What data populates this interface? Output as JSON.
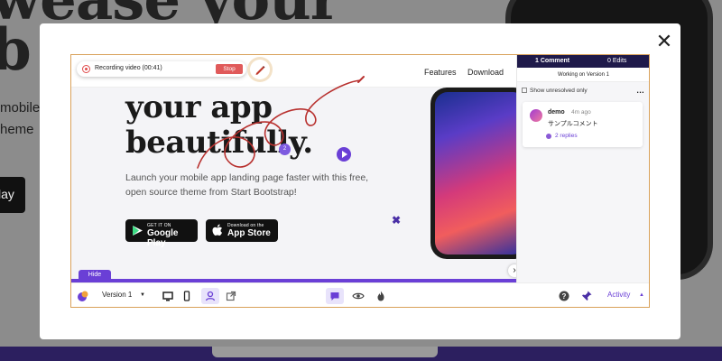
{
  "background": {
    "hero_text": "wease your",
    "hero_text_line2": "b",
    "sub_line1": "mobile",
    "sub_line2": "heme",
    "button_partial": "lay"
  },
  "recording": {
    "status": "Recording video (00:41)",
    "stop_label": "Stop"
  },
  "nav": {
    "links": [
      "Features",
      "Download"
    ]
  },
  "hero": {
    "title_line1": "your app",
    "title_line2": "beautifully.",
    "subtitle": "Launch your mobile app landing page faster with this free, open source theme from Start Bootstrap!",
    "pin_number": "2"
  },
  "stores": {
    "google_small": "GET IT ON",
    "google_big": "Google Play",
    "apple_small": "Download on the",
    "apple_big": "App Store"
  },
  "hide_label": "Hide",
  "progress_fraction": 1.0,
  "panel": {
    "tab_comments": "1 Comment",
    "tab_edits": "0 Edits",
    "version_line": "Working on Version 1",
    "show_unresolved": "Show unresolved only",
    "comment": {
      "author": "demo",
      "time": "4m ago",
      "body": "サンプルコメント",
      "replies": "2 replies"
    }
  },
  "toolbar": {
    "version": "Version 1",
    "activity": "Activity"
  },
  "colors": {
    "accent": "#6a3fd6",
    "frame_border": "#d9a15a",
    "stop": "#e05a5a",
    "panel_header": "#1f1a4a"
  }
}
